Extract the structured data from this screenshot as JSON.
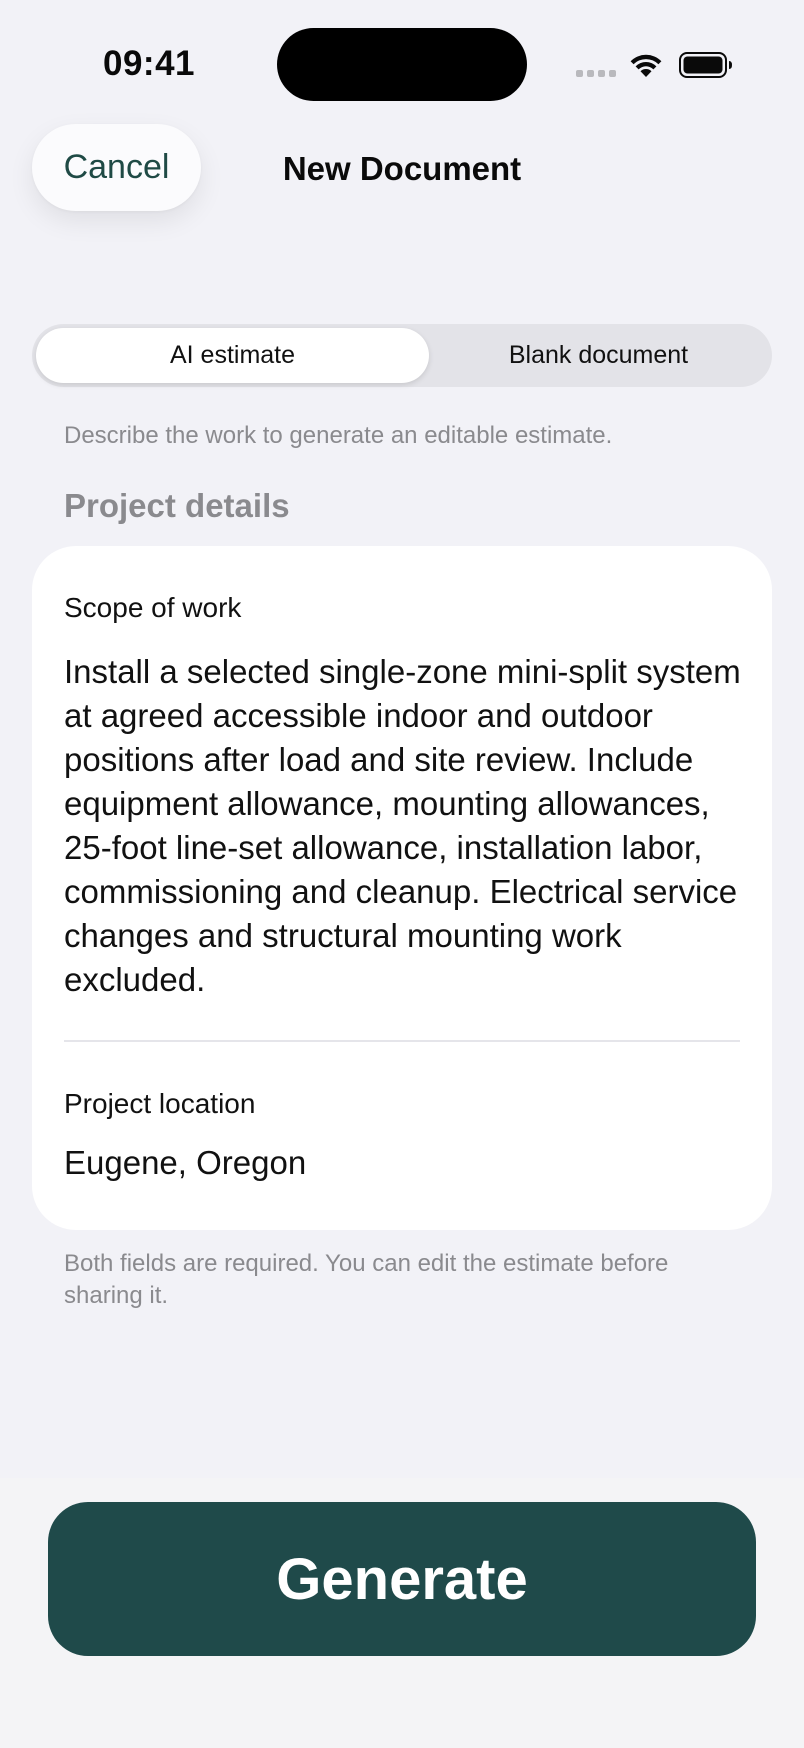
{
  "status_bar": {
    "time": "09:41",
    "icons": [
      "signal-icon",
      "wifi-icon",
      "battery-icon"
    ]
  },
  "nav": {
    "cancel_label": "Cancel",
    "title": "New Document"
  },
  "mode_selector": {
    "options": [
      {
        "label": "AI estimate",
        "selected": true
      },
      {
        "label": "Blank document",
        "selected": false
      }
    ]
  },
  "helper_text": "Describe the work to generate an editable estimate.",
  "section_heading": "Project details",
  "form": {
    "scope_label": "Scope of work",
    "scope_value": "Install a selected single-zone mini-split system at agreed accessible indoor and outdoor positions after load and site review. Include equipment allowance, mounting allowances, 25-foot line-set allowance, installation labor, commissioning and cleanup. Electrical service changes and structural mounting work excluded.",
    "location_label": "Project location",
    "location_value": "Eugene, Oregon"
  },
  "footnote": "Both fields are required. You can edit the estimate before sharing it.",
  "generate_label": "Generate",
  "colors": {
    "accent": "#1f4a4a",
    "background": "#f2f2f7",
    "card": "#ffffff",
    "secondary_text": "#8a8a8e"
  }
}
